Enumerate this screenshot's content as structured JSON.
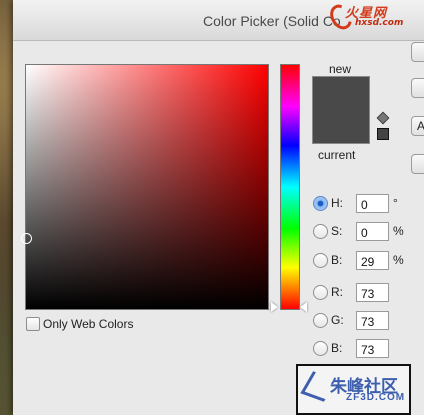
{
  "window": {
    "title": "Color Picker (Solid Co"
  },
  "watermark": {
    "line1": "火星网",
    "line2": "hxsd.com"
  },
  "preview": {
    "new_label": "new",
    "current_label": "current",
    "new_color": "#494949",
    "current_color": "#494949"
  },
  "fields": [
    {
      "label": "H:",
      "value": "0",
      "unit": "°",
      "selected": true
    },
    {
      "label": "S:",
      "value": "0",
      "unit": "%",
      "selected": false
    },
    {
      "label": "B:",
      "value": "29",
      "unit": "%",
      "selected": false
    },
    {
      "label": "R:",
      "value": "73",
      "unit": "",
      "selected": false
    },
    {
      "label": "G:",
      "value": "73",
      "unit": "",
      "selected": false
    },
    {
      "label": "B:",
      "value": "73",
      "unit": "",
      "selected": false
    }
  ],
  "only_web_colors": {
    "label": "Only Web Colors",
    "checked": false
  },
  "side_buttons": {
    "third_label": "A"
  },
  "bottom_watermark": {
    "text": "朱峰社区",
    "sub": "ZF3D.COM"
  },
  "colors": {
    "hue_base": "#ff0000",
    "radio_selected": "#1d5fc7",
    "dialog_bg": "#e9e9e9"
  },
  "icons": {
    "out_of_gamut": "cube-icon",
    "web_safe": "websafe-swatch-icon"
  }
}
